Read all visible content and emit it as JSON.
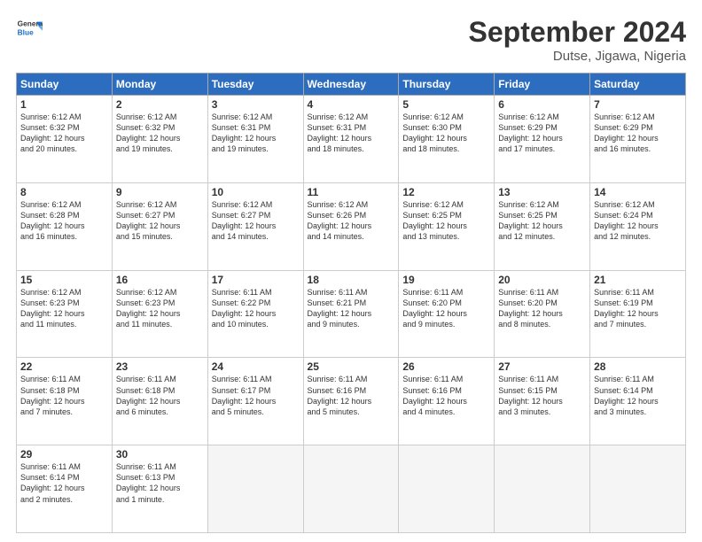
{
  "header": {
    "logo_general": "General",
    "logo_blue": "Blue",
    "month": "September 2024",
    "location": "Dutse, Jigawa, Nigeria"
  },
  "days": [
    "Sunday",
    "Monday",
    "Tuesday",
    "Wednesday",
    "Thursday",
    "Friday",
    "Saturday"
  ],
  "cells": [
    {
      "day": null,
      "empty": true
    },
    {
      "day": null,
      "empty": true
    },
    {
      "day": null,
      "empty": true
    },
    {
      "day": null,
      "empty": true
    },
    {
      "day": null,
      "empty": true
    },
    {
      "day": null,
      "empty": true
    },
    {
      "num": "1",
      "lines": [
        "Sunrise: 6:12 AM",
        "Sunset: 6:32 PM",
        "Daylight: 12 hours",
        "and 20 minutes."
      ]
    },
    {
      "num": "2",
      "lines": [
        "Sunrise: 6:12 AM",
        "Sunset: 6:32 PM",
        "Daylight: 12 hours",
        "and 19 minutes."
      ]
    },
    {
      "num": "3",
      "lines": [
        "Sunrise: 6:12 AM",
        "Sunset: 6:31 PM",
        "Daylight: 12 hours",
        "and 19 minutes."
      ]
    },
    {
      "num": "4",
      "lines": [
        "Sunrise: 6:12 AM",
        "Sunset: 6:31 PM",
        "Daylight: 12 hours",
        "and 18 minutes."
      ]
    },
    {
      "num": "5",
      "lines": [
        "Sunrise: 6:12 AM",
        "Sunset: 6:30 PM",
        "Daylight: 12 hours",
        "and 18 minutes."
      ]
    },
    {
      "num": "6",
      "lines": [
        "Sunrise: 6:12 AM",
        "Sunset: 6:29 PM",
        "Daylight: 12 hours",
        "and 17 minutes."
      ]
    },
    {
      "num": "7",
      "lines": [
        "Sunrise: 6:12 AM",
        "Sunset: 6:29 PM",
        "Daylight: 12 hours",
        "and 16 minutes."
      ]
    },
    {
      "num": "8",
      "lines": [
        "Sunrise: 6:12 AM",
        "Sunset: 6:28 PM",
        "Daylight: 12 hours",
        "and 16 minutes."
      ]
    },
    {
      "num": "9",
      "lines": [
        "Sunrise: 6:12 AM",
        "Sunset: 6:27 PM",
        "Daylight: 12 hours",
        "and 15 minutes."
      ]
    },
    {
      "num": "10",
      "lines": [
        "Sunrise: 6:12 AM",
        "Sunset: 6:27 PM",
        "Daylight: 12 hours",
        "and 14 minutes."
      ]
    },
    {
      "num": "11",
      "lines": [
        "Sunrise: 6:12 AM",
        "Sunset: 6:26 PM",
        "Daylight: 12 hours",
        "and 14 minutes."
      ]
    },
    {
      "num": "12",
      "lines": [
        "Sunrise: 6:12 AM",
        "Sunset: 6:25 PM",
        "Daylight: 12 hours",
        "and 13 minutes."
      ]
    },
    {
      "num": "13",
      "lines": [
        "Sunrise: 6:12 AM",
        "Sunset: 6:25 PM",
        "Daylight: 12 hours",
        "and 12 minutes."
      ]
    },
    {
      "num": "14",
      "lines": [
        "Sunrise: 6:12 AM",
        "Sunset: 6:24 PM",
        "Daylight: 12 hours",
        "and 12 minutes."
      ]
    },
    {
      "num": "15",
      "lines": [
        "Sunrise: 6:12 AM",
        "Sunset: 6:23 PM",
        "Daylight: 12 hours",
        "and 11 minutes."
      ]
    },
    {
      "num": "16",
      "lines": [
        "Sunrise: 6:12 AM",
        "Sunset: 6:23 PM",
        "Daylight: 12 hours",
        "and 11 minutes."
      ]
    },
    {
      "num": "17",
      "lines": [
        "Sunrise: 6:11 AM",
        "Sunset: 6:22 PM",
        "Daylight: 12 hours",
        "and 10 minutes."
      ]
    },
    {
      "num": "18",
      "lines": [
        "Sunrise: 6:11 AM",
        "Sunset: 6:21 PM",
        "Daylight: 12 hours",
        "and 9 minutes."
      ]
    },
    {
      "num": "19",
      "lines": [
        "Sunrise: 6:11 AM",
        "Sunset: 6:20 PM",
        "Daylight: 12 hours",
        "and 9 minutes."
      ]
    },
    {
      "num": "20",
      "lines": [
        "Sunrise: 6:11 AM",
        "Sunset: 6:20 PM",
        "Daylight: 12 hours",
        "and 8 minutes."
      ]
    },
    {
      "num": "21",
      "lines": [
        "Sunrise: 6:11 AM",
        "Sunset: 6:19 PM",
        "Daylight: 12 hours",
        "and 7 minutes."
      ]
    },
    {
      "num": "22",
      "lines": [
        "Sunrise: 6:11 AM",
        "Sunset: 6:18 PM",
        "Daylight: 12 hours",
        "and 7 minutes."
      ]
    },
    {
      "num": "23",
      "lines": [
        "Sunrise: 6:11 AM",
        "Sunset: 6:18 PM",
        "Daylight: 12 hours",
        "and 6 minutes."
      ]
    },
    {
      "num": "24",
      "lines": [
        "Sunrise: 6:11 AM",
        "Sunset: 6:17 PM",
        "Daylight: 12 hours",
        "and 5 minutes."
      ]
    },
    {
      "num": "25",
      "lines": [
        "Sunrise: 6:11 AM",
        "Sunset: 6:16 PM",
        "Daylight: 12 hours",
        "and 5 minutes."
      ]
    },
    {
      "num": "26",
      "lines": [
        "Sunrise: 6:11 AM",
        "Sunset: 6:16 PM",
        "Daylight: 12 hours",
        "and 4 minutes."
      ]
    },
    {
      "num": "27",
      "lines": [
        "Sunrise: 6:11 AM",
        "Sunset: 6:15 PM",
        "Daylight: 12 hours",
        "and 3 minutes."
      ]
    },
    {
      "num": "28",
      "lines": [
        "Sunrise: 6:11 AM",
        "Sunset: 6:14 PM",
        "Daylight: 12 hours",
        "and 3 minutes."
      ]
    },
    {
      "num": "29",
      "lines": [
        "Sunrise: 6:11 AM",
        "Sunset: 6:14 PM",
        "Daylight: 12 hours",
        "and 2 minutes."
      ]
    },
    {
      "num": "30",
      "lines": [
        "Sunrise: 6:11 AM",
        "Sunset: 6:13 PM",
        "Daylight: 12 hours",
        "and 1 minute."
      ]
    },
    {
      "day": null,
      "empty": true
    },
    {
      "day": null,
      "empty": true
    },
    {
      "day": null,
      "empty": true
    },
    {
      "day": null,
      "empty": true
    },
    {
      "day": null,
      "empty": true
    }
  ]
}
